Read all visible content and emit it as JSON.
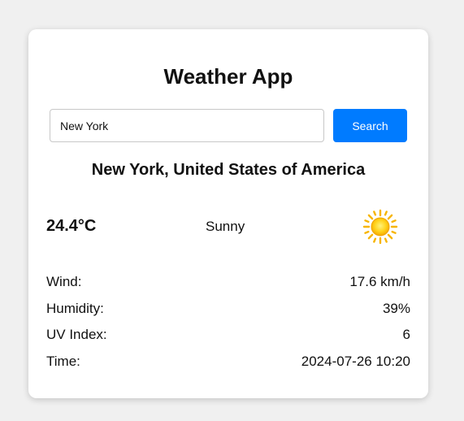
{
  "app": {
    "title": "Weather App"
  },
  "search": {
    "value": "New York",
    "placeholder": "",
    "button_label": "Search"
  },
  "location": "New York, United States of America",
  "current": {
    "temperature": "24.4°C",
    "condition": "Sunny",
    "icon": "sun-icon"
  },
  "details": [
    {
      "label": "Wind:",
      "value": "17.6 km/h"
    },
    {
      "label": "Humidity:",
      "value": "39%"
    },
    {
      "label": "UV Index:",
      "value": "6"
    },
    {
      "label": "Time:",
      "value": "2024-07-26 10:20"
    }
  ],
  "colors": {
    "background": "#f0f0f0",
    "card": "#ffffff",
    "accent": "#007bff",
    "sun": "#ffcc00"
  }
}
